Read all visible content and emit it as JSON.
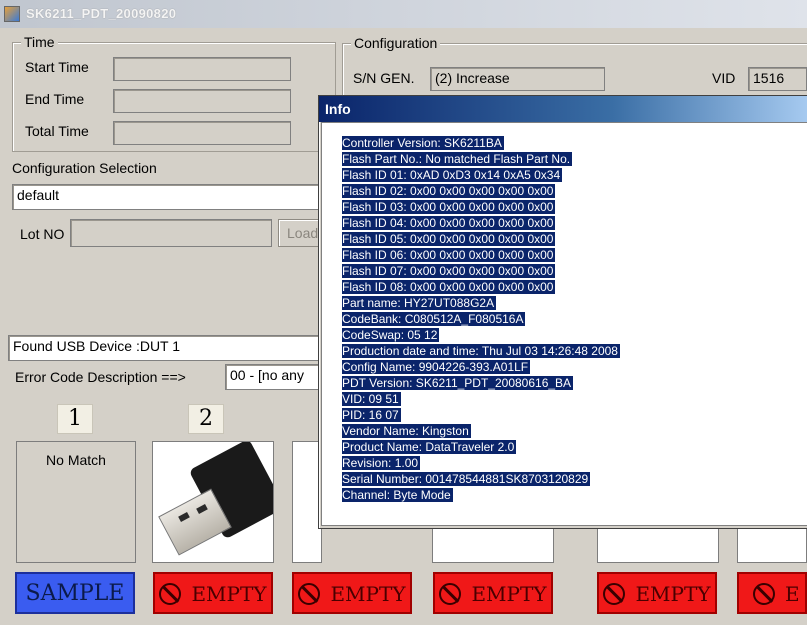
{
  "window": {
    "title": "SK6211_PDT_20090820"
  },
  "time": {
    "group_label": "Time",
    "start_label": "Start Time",
    "end_label": "End Time",
    "total_label": "Total Time",
    "start_value": "",
    "end_value": "",
    "total_value": ""
  },
  "config_selection": {
    "label": "Configuration Selection",
    "value": "default"
  },
  "lot": {
    "label": "Lot NO",
    "value": "",
    "load_button": "Load"
  },
  "configuration": {
    "group_label": "Configuration",
    "sn_label": "S/N GEN.",
    "sn_value": "(2) Increase",
    "vid_label": "VID",
    "vid_value": "1516"
  },
  "status": {
    "found_device": "Found USB Device :DUT 1"
  },
  "error_code": {
    "label": "Error Code Description ==>",
    "value": "00 - [no any"
  },
  "slots": [
    {
      "number": "1",
      "text": "No Match",
      "status": "SAMPLE"
    },
    {
      "number": "2",
      "text": "",
      "status": "EMPTY"
    },
    {
      "number": "",
      "text": "",
      "status": "EMPTY"
    },
    {
      "number": "",
      "text": "",
      "status": "EMPTY"
    },
    {
      "number": "",
      "text": "",
      "status": "EMPTY"
    },
    {
      "number": "",
      "text": "",
      "status": "E"
    }
  ],
  "info_dialog": {
    "title": "Info",
    "lines": [
      "Controller Version: SK6211BA",
      "Flash Part No.: No matched Flash Part No.",
      "Flash ID 01: 0xAD 0xD3 0x14 0xA5 0x34",
      "Flash ID 02: 0x00 0x00 0x00 0x00 0x00",
      "Flash ID 03: 0x00 0x00 0x00 0x00 0x00",
      "Flash ID 04: 0x00 0x00 0x00 0x00 0x00",
      "Flash ID 05: 0x00 0x00 0x00 0x00 0x00",
      "Flash ID 06: 0x00 0x00 0x00 0x00 0x00",
      "Flash ID 07: 0x00 0x00 0x00 0x00 0x00",
      "Flash ID 08: 0x00 0x00 0x00 0x00 0x00",
      "Part name: HY27UT088G2A",
      "CodeBank: C080512A_F080516A",
      "CodeSwap: 05 12",
      "Production date and time: Thu Jul 03 14:26:48 2008",
      "Config Name: 9904226-393.A01LF",
      "PDT Version: SK6211_PDT_20080616_BA",
      "VID: 09 51",
      "PID: 16 07",
      "Vendor Name: Kingston",
      "Product Name: DataTraveler 2.0",
      "Revision: 1.00",
      "Serial Number: 001478544881SK8703120829",
      "Channel: Byte Mode"
    ]
  },
  "colors": {
    "sample_button": "#3a5cf0",
    "empty_button": "#f01818",
    "selection_highlight": "#0a246a",
    "dialog_title_gradient_start": "#0a246a"
  }
}
